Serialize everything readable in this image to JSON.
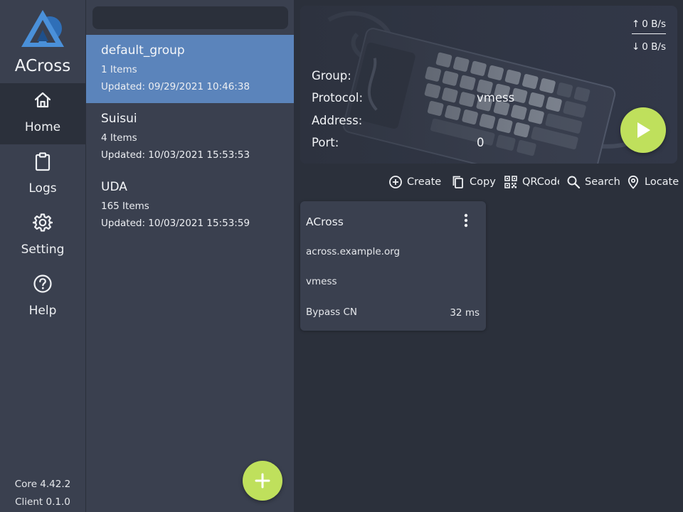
{
  "app": {
    "title": "ACross"
  },
  "sidebar": {
    "items": [
      {
        "label": "Home",
        "icon": "home-icon",
        "active": true
      },
      {
        "label": "Logs",
        "icon": "clipboard-icon",
        "active": false
      },
      {
        "label": "Setting",
        "icon": "gear-icon",
        "active": false
      },
      {
        "label": "Help",
        "icon": "help-circle-icon",
        "active": false
      }
    ],
    "core_version": "Core 4.42.2",
    "client_version": "Client 0.1.0"
  },
  "groups": {
    "search_value": "",
    "items": [
      {
        "name": "default_group",
        "count": "1 Items",
        "updated": "Updated: 09/29/2021 10:46:38",
        "selected": true
      },
      {
        "name": "Suisui",
        "count": "4 Items",
        "updated": "Updated: 10/03/2021 15:53:53",
        "selected": false
      },
      {
        "name": "UDA",
        "count": "165 Items",
        "updated": "Updated: 10/03/2021 15:53:59",
        "selected": false
      }
    ]
  },
  "status": {
    "upload_speed": "0 B/s",
    "download_speed": "0 B/s",
    "group_label": "Group:",
    "group_value": "",
    "protocol_label": "Protocol:",
    "protocol_value": "vmess",
    "address_label": "Address:",
    "address_value": "",
    "port_label": "Port:",
    "port_value": "0"
  },
  "toolbar": {
    "create": "Create",
    "copy": "Copy",
    "qrcode": "QRCode",
    "search": "Search",
    "locate": "Locate"
  },
  "servers": [
    {
      "name": "ACross",
      "address": "across.example.org",
      "protocol": "vmess",
      "routing": "Bypass CN",
      "latency": "32 ms"
    }
  ],
  "colors": {
    "background": "#2b303b",
    "panel": "#3a404f",
    "selected": "#5b84bb",
    "accent": "#bfe05c",
    "logo_blue": "#4a90d9"
  }
}
